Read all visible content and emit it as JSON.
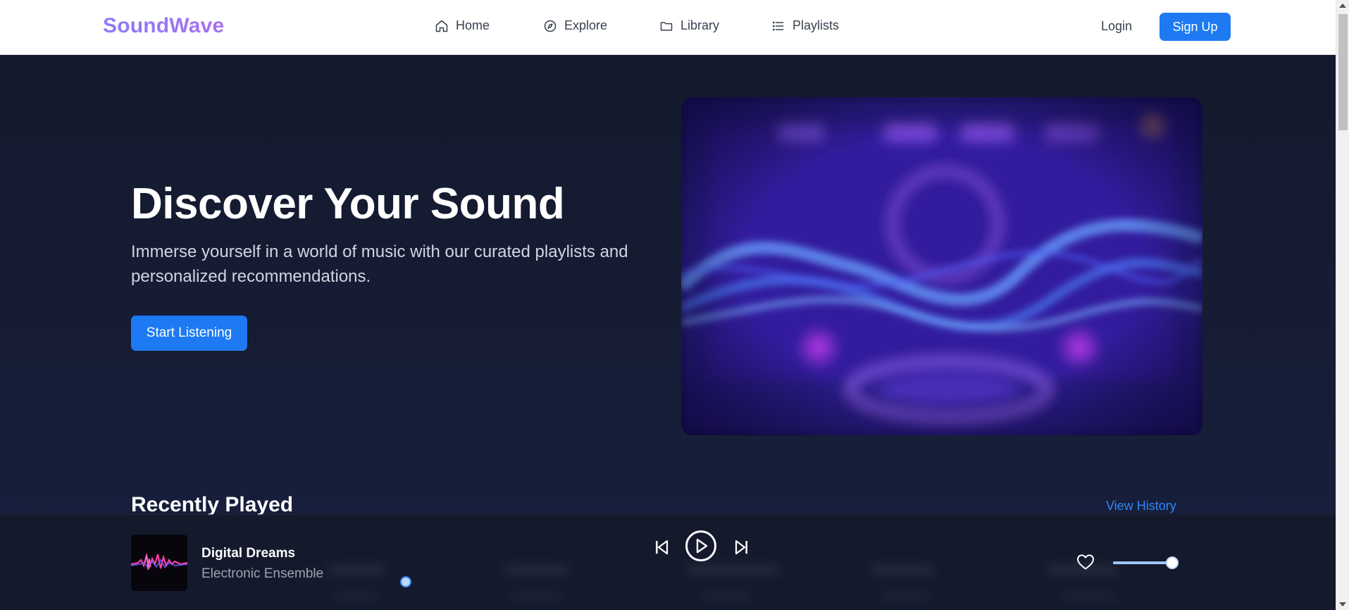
{
  "navbar": {
    "logo": "SoundWave",
    "links": [
      {
        "label": "Home",
        "icon": "home-icon"
      },
      {
        "label": "Explore",
        "icon": "compass-icon"
      },
      {
        "label": "Library",
        "icon": "folder-icon"
      },
      {
        "label": "Playlists",
        "icon": "list-icon"
      }
    ],
    "login_label": "Login",
    "signup_label": "Sign Up"
  },
  "hero": {
    "title": "Discover Your Sound",
    "subtitle": "Immerse yourself in a world of music with our curated playlists and personalized recommendations.",
    "button_label": "Start Listening",
    "image_icon": "music-wave-illustration"
  },
  "recently_played": {
    "title": "Recently Played",
    "view_history_label": "View History"
  },
  "player": {
    "track_title": "Digital Dreams",
    "track_artist": "Electronic Ensemble",
    "controls": [
      "previous-icon",
      "play-icon",
      "next-icon"
    ],
    "like_icon": "heart-icon",
    "volume": 0.88
  },
  "colors": {
    "accent": "#1d7af3",
    "logo_gradient_start": "#8b7cf6",
    "logo_gradient_end": "#a870f0",
    "background": "#141a2e",
    "link": "#2f86f6"
  }
}
